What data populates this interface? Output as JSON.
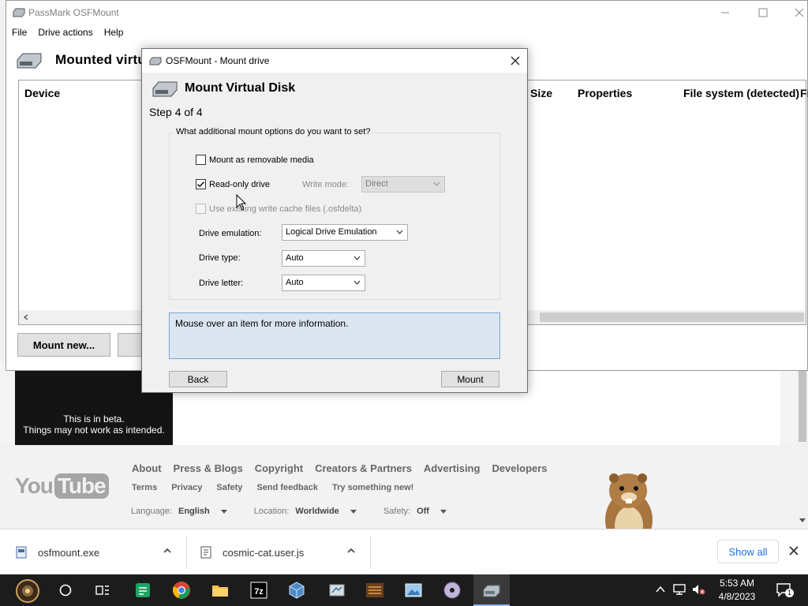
{
  "main_window": {
    "title": "PassMark OSFMount",
    "menu": [
      "File",
      "Drive actions",
      "Help"
    ],
    "header_title": "Mounted virtual disks",
    "columns": [
      "Device",
      "Size",
      "Properties",
      "File system (detected)",
      "Fi"
    ],
    "mount_new_label": "Mount new..."
  },
  "dialog": {
    "title": "OSFMount - Mount drive",
    "heading": "Mount Virtual Disk",
    "step": "Step 4 of 4",
    "group_label": "What additional mount options do you want to set?",
    "removable_media_label": "Mount as removable media",
    "removable_media_checked": false,
    "readonly_label": "Read-only drive",
    "readonly_checked": true,
    "write_mode_label": "Write mode:",
    "write_mode_value": "Direct",
    "use_cache_label": "Use existing write cache files (.osfdelta)",
    "drive_emulation_label": "Drive emulation:",
    "drive_emulation_value": "Logical Drive Emulation",
    "drive_type_label": "Drive type:",
    "drive_type_value": "Auto",
    "drive_letter_label": "Drive letter:",
    "drive_letter_value": "Auto",
    "info_text": "Mouse over an item for more information.",
    "back_label": "Back",
    "mount_label": "Mount"
  },
  "browser_page": {
    "beta_line1": "This is in beta.",
    "beta_line2": "Things may not work as intended.",
    "logo_you": "You",
    "logo_tube": "Tube",
    "footer_links_1": [
      "About",
      "Press & Blogs",
      "Copyright",
      "Creators & Partners",
      "Advertising",
      "Developers"
    ],
    "footer_links_2": [
      "Terms",
      "Privacy",
      "Safety",
      "Send feedback",
      "Try something new!"
    ],
    "language_label": "Language:",
    "language_value": "English",
    "location_label": "Location:",
    "location_value": "Worldwide",
    "safety_label": "Safety:",
    "safety_value": "Off"
  },
  "downloads": {
    "items": [
      "osfmount.exe",
      "cosmic-cat.user.js"
    ],
    "show_all": "Show all"
  },
  "taskbar": {
    "time": "5:53 AM",
    "date": "4/8/2023",
    "notification_count": "1"
  },
  "colors": {
    "info_bg": "#dce6f1",
    "info_border": "#7aa7d6",
    "taskbar_bg": "#1c1c1c",
    "link_blue": "#1a73e8"
  }
}
